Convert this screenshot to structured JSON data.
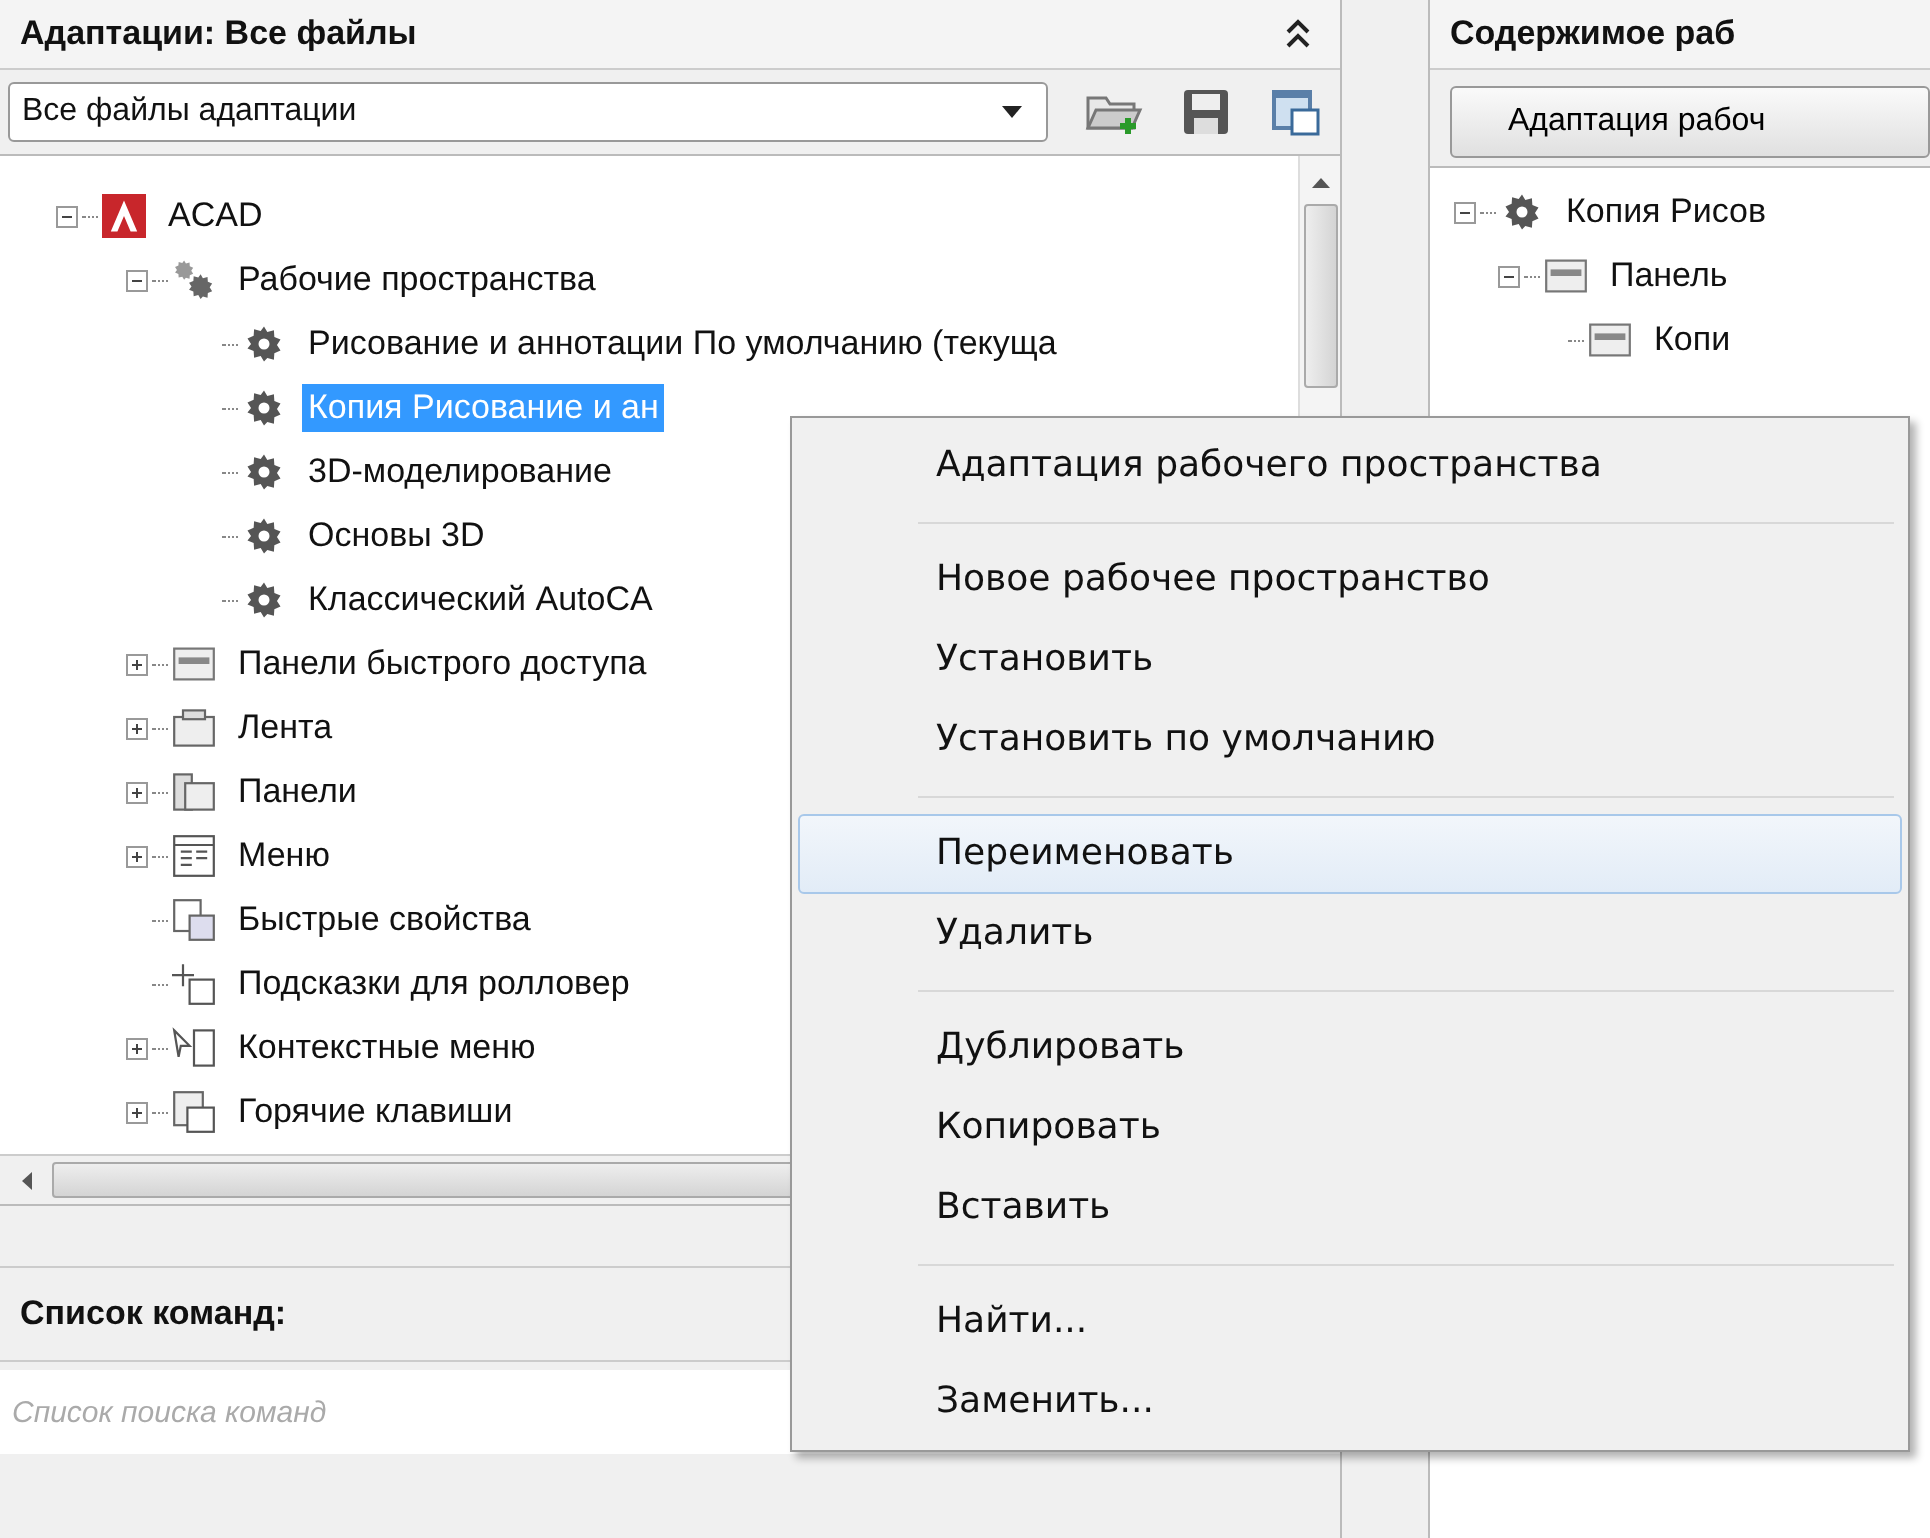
{
  "left_panel": {
    "title": "Адаптации: Все файлы",
    "file_select": {
      "value": "Все файлы адаптации"
    },
    "tree": [
      {
        "label": "ACAD",
        "kind": "acad",
        "expanded": true,
        "selected": false,
        "children": [
          {
            "label": "Рабочие пространства",
            "kind": "gears",
            "expanded": true,
            "selected": false,
            "children": [
              {
                "label": "Рисование и аннотации По умолчанию (текуща",
                "kind": "gear",
                "selected": false
              },
              {
                "label": "Копия Рисование и ан",
                "kind": "gear",
                "selected": true
              },
              {
                "label": "3D-моделирование",
                "kind": "gear",
                "selected": false
              },
              {
                "label": "Основы 3D",
                "kind": "gear",
                "selected": false
              },
              {
                "label": "Классический AutoCA",
                "kind": "gear",
                "selected": false
              }
            ]
          },
          {
            "label": "Панели быстрого доступа",
            "kind": "toolbar",
            "expanded": false,
            "selected": false
          },
          {
            "label": "Лента",
            "kind": "ribbon",
            "expanded": false,
            "selected": false
          },
          {
            "label": "Панели",
            "kind": "panels",
            "expanded": false,
            "selected": false
          },
          {
            "label": "Меню",
            "kind": "menu",
            "expanded": false,
            "selected": false
          },
          {
            "label": "Быстрые свойства",
            "kind": "props",
            "selected": false
          },
          {
            "label": "Подсказки для ролловер",
            "kind": "tooltip",
            "selected": false
          },
          {
            "label": "Контекстные меню",
            "kind": "context",
            "expanded": false,
            "selected": false
          },
          {
            "label": "Горячие клавиши",
            "kind": "keys",
            "expanded": false,
            "selected": false
          }
        ]
      }
    ],
    "commands": {
      "title": "Список команд:",
      "search": {
        "placeholder": "Список поиска команд"
      }
    }
  },
  "right_panel": {
    "title": "Содержимое раб",
    "button": "Адаптация рабоч",
    "tree": [
      {
        "label": "Копия Рисов",
        "kind": "gear",
        "expanded": true,
        "selected": false,
        "children": [
          {
            "label": "Панель",
            "kind": "toolbar",
            "expanded": true,
            "selected": false,
            "children": [
              {
                "label": "Копи",
                "kind": "toolbar",
                "selected": false
              }
            ]
          }
        ]
      }
    ]
  },
  "context_menu": {
    "groups": [
      [
        {
          "label": "Адаптация рабочего пространства",
          "selected": false
        }
      ],
      [
        {
          "label": "Новое рабочее пространство",
          "selected": false
        },
        {
          "label": "Установить",
          "selected": false
        },
        {
          "label": "Установить по умолчанию",
          "selected": false
        }
      ],
      [
        {
          "label": "Переименовать",
          "selected": true
        },
        {
          "label": "Удалить",
          "selected": false
        }
      ],
      [
        {
          "label": "Дублировать",
          "selected": false
        },
        {
          "label": "Копировать",
          "selected": false
        },
        {
          "label": "Вставить",
          "selected": false
        }
      ],
      [
        {
          "label": "Найти...",
          "selected": false
        },
        {
          "label": "Заменить...",
          "selected": false
        }
      ]
    ]
  }
}
